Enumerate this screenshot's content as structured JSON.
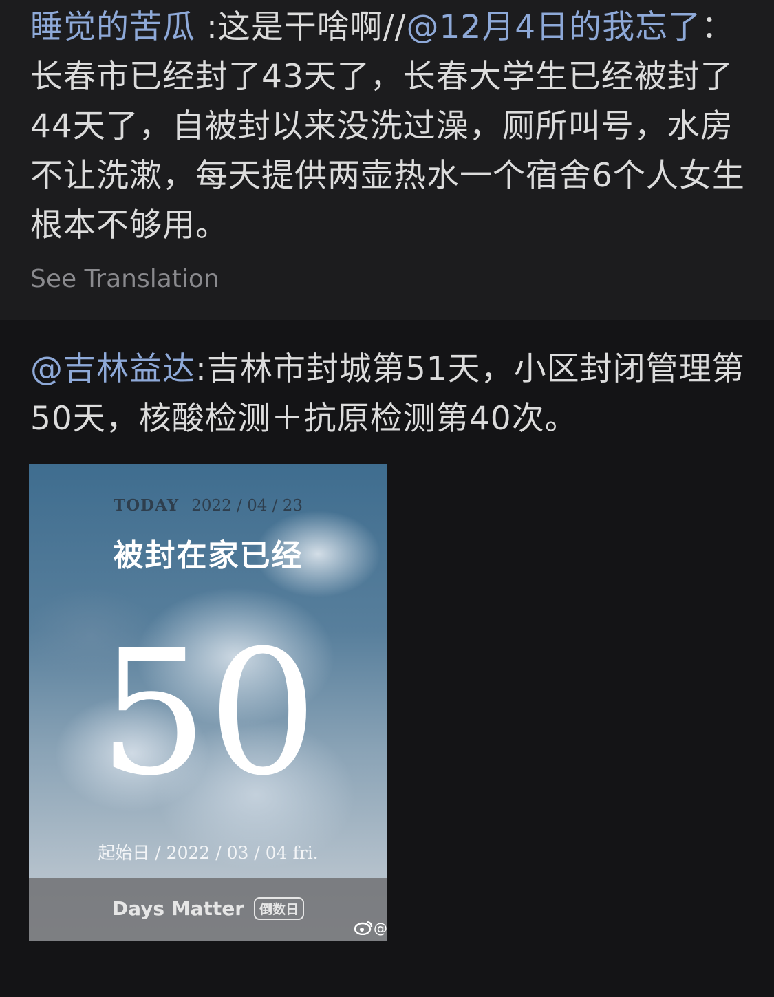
{
  "post1": {
    "author": "睡觉的苦瓜",
    "text_a": " :这是干啥啊//",
    "mention": "@12月4日的我忘了",
    "text_b": "：长春市已经封了43天了，长春大学生已经被封了44天了，自被封以来没洗过澡，厕所叫号，水房不让洗漱，每天提供两壶热水一个宿舍6个人女生根本不够用。",
    "see_translation": "See Translation"
  },
  "post2": {
    "mention": "@吉林益达",
    "text": ":吉林市封城第51天，小区封闭管理第50天，核酸检测＋抗原检测第40次。",
    "image": {
      "today_label": "TODAY",
      "today_date": "2022 / 04 / 23",
      "title": "被封在家已经",
      "number": "50",
      "start": "起始日 / 2022 / 03 / 04 fri.",
      "app_name": "Days Matter",
      "app_badge": "倒数日",
      "watermark": "@"
    }
  },
  "colors": {
    "background": "#1c1c1e",
    "text": "#dcdcdc",
    "link": "#8ea9d8",
    "muted": "#8a8a8e"
  }
}
